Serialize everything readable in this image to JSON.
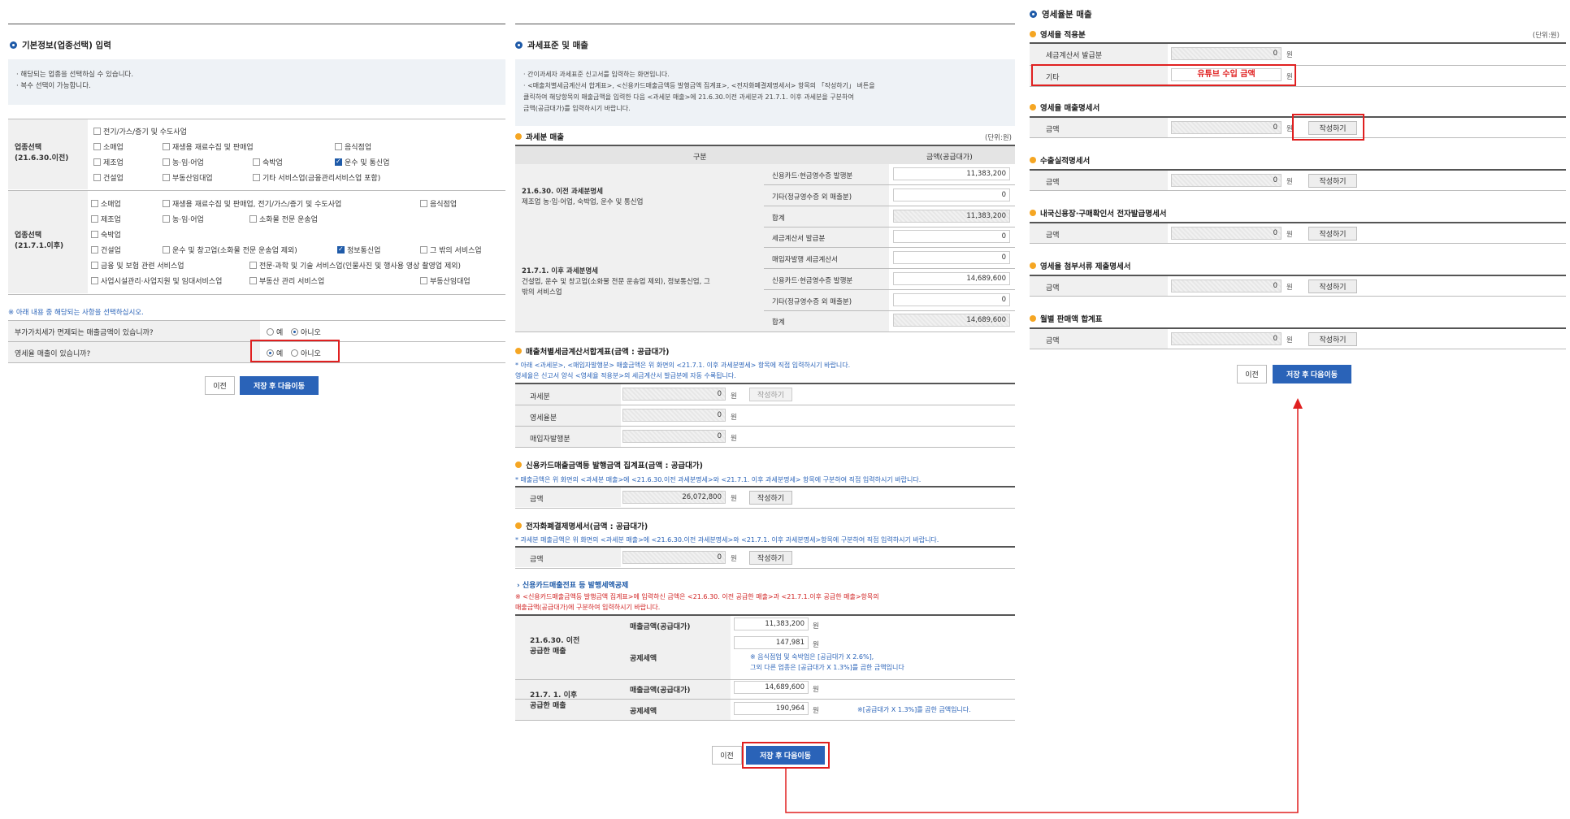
{
  "left": {
    "section_title": "기본정보(업종선택) 입력",
    "info": [
      "· 해당되는 업종을 선택하실 수 있습니다.",
      "· 복수 선택이 가능합니다."
    ],
    "group1_label": [
      "업종선택",
      "(21.6.30.이전)"
    ],
    "group1_options": [
      "전기/가스/증기 및 수도사업",
      "소매업",
      "재생용 재료수집 및 판매업",
      "음식점업",
      "제조업",
      "농·임·어업",
      "숙박업",
      "운수 및 통신업",
      "건설업",
      "부동산임대업",
      "기타 서비스업(금융관리서비스업 포함)"
    ],
    "group2_label": [
      "업종선택",
      "(21.7.1.이후)"
    ],
    "group2_options": [
      "소매업",
      "재생용 재료수집 및 판매업, 전기/가스/증기 및 수도사업",
      "음식점업",
      "제조업",
      "농·임·어업",
      "소화물 전문 운송업",
      "숙박업",
      "건설업",
      "운수 및 창고업(소화물 전문 운송업 제외)",
      "정보통신업",
      "그 밖의 서비스업",
      "금융 및 보험 관련 서비스업",
      "전문·과학 및 기술 서비스업(인물사진 및 행사용 영상 촬영업 제외)",
      "사업시설관리·사업지원 및 임대서비스업",
      "부동산 관리 서비스업",
      "부동산임대업"
    ],
    "notice": "※ 아래 내용 중 해당되는 사항을 선택하십시오.",
    "q1": "부가가치세가 면제되는 매출금액이 있습니까?",
    "q2": "영세율 매출이 있습니까?",
    "yes": "예",
    "no": "아니오",
    "btn_prev": "이전",
    "btn_save": "저장 후 다음이동"
  },
  "mid": {
    "section_title": "과세표준 및 매출",
    "info": [
      "· 간이과세자 과세표준 신고서를 입력하는 화면입니다.",
      "· <매출처별세금계산서 합계표>, <신용카드매출금액등 발행금액 집계표>, <전자화폐결제명세서> 항목의 「작성하기」 버튼을",
      "  클릭하여 해당항목의 매출금액을 입력한 다음 <과세분 매출>에 21.6.30.이전 과세분과 21.7.1. 이후 과세분을 구분하여",
      "  금액(공급대가)를 입력하시기 바랍니다."
    ],
    "taxable_title": "과세분 매출",
    "unit": "(단위:원)",
    "col_div": "구분",
    "col_amount": "금액(공급대가)",
    "group_before": [
      "21.6.30. 이전 과세분명세",
      "제조업 농·임·어업, 숙박업, 운수 및 통신업"
    ],
    "group_after": [
      "21.7.1. 이후 과세분명세",
      "건설업, 운수 및 창고업(소화물 전문 운송업 제외), 정보통신업, 그",
      "밖의 서비스업"
    ],
    "rows": [
      {
        "label": "신용카드·현금영수증 발행분",
        "value": "11,383,200"
      },
      {
        "label": "기타(정규영수증 외 매출분)",
        "value": "0"
      },
      {
        "label": "합계",
        "value": "11,383,200"
      },
      {
        "label": "세금계산서 발급분",
        "value": "0"
      },
      {
        "label": "매입자발행 세금계산서",
        "value": "0"
      },
      {
        "label": "신용카드·현금영수증 발행분",
        "value": "14,689,600"
      },
      {
        "label": "기타(정규영수증 외 매출분)",
        "value": "0"
      },
      {
        "label": "합계",
        "value": "14,689,600"
      }
    ],
    "sales_invoice_title": "매출처별세금계산서합계표(금액 : 공급대가)",
    "sales_invoice_note": [
      "* 아래 <과세분>, <매입자발행분> 매출금액은 위 화면의 <21.7.1. 이후 과세분명세> 항목에 직접 입력하시기 바랍니다.",
      "  영세율은 신고서 양식 <영세율 적용분>의 세금계산서 발급분에 자동 수록됩니다."
    ],
    "si_rows": [
      {
        "label": "과세분",
        "value": "0"
      },
      {
        "label": "영세율분",
        "value": "0"
      },
      {
        "label": "매입자발행분",
        "value": "0"
      }
    ],
    "card_title": "신용카드매출금액등 발행금액 집계표(금액 : 공급대가)",
    "card_note": "* 매출금액은 위 화면의 <과세분 매출>에 <21.6.30.이전 과세분명세>와 <21.7.1. 이후 과세분명세> 항목에 구분하여 직접 입력하시기 바랍니다.",
    "card_value": "26,072,800",
    "emoney_title": "전자화폐결제명세서(금액 : 공급대가)",
    "emoney_note": "* 과세분 매출금액은 위 화면의 <과세분 매출>에 <21.6.30.이전 과세분명세>와 <21.7.1. 이후 과세분명세>항목에 구분하여 직접 입력하시기 바랍니다.",
    "emoney_value": "0",
    "amount_label": "금액",
    "won": "원",
    "write_btn": "작성하기",
    "credit_title": "› 신용카드매출전표 등 발행세액공제",
    "credit_note": [
      "※ <신용카드매출금액등 발행금액 집계표>에 입력하신 금액은 <21.6.30. 이전 공급한 매출>과 <21.7.1.이후 공급한 매출>항목의",
      "   매출금액(공급대가)에 구분하여 입력하시기 바랍니다."
    ],
    "cr_before_label": [
      "21.6.30. 이전",
      "공급한 매출"
    ],
    "cr_after_label": [
      "21.7. 1. 이후",
      "공급한 매출"
    ],
    "cr_sales_label": "매출금액(공급대가)",
    "cr_deduct_label": "공제세액",
    "cr_before_sales": "11,383,200",
    "cr_before_deduct": "147,981",
    "cr_before_note": [
      "※ 음식점업 및 숙박업은 [공급대가 X 2.6%],",
      "   그외 다른 업종은 [공급대가 X 1.3%]를 곱한 금액입니다"
    ],
    "cr_after_sales": "14,689,600",
    "cr_after_deduct": "190,964",
    "cr_after_note": "※[공급대가 X 1.3%]를 곱한 금액입니다.",
    "btn_prev": "이전",
    "btn_save": "저장 후 다음이동"
  },
  "right": {
    "section_title": "영세율분 매출",
    "unit": "(단위:원)",
    "applied_title": "영세율 적용분",
    "invoice_label": "세금계산서 발급분",
    "invoice_value": "0",
    "etc_label": "기타",
    "etc_value": "유튜브 수입 금액",
    "groups": [
      {
        "title": "영세율 매출명세서",
        "label": "금액",
        "value": "0"
      },
      {
        "title": "수출실적명세서",
        "label": "금액",
        "value": "0"
      },
      {
        "title": "내국신용장·구매확인서 전자발급명세서",
        "label": "금액",
        "value": "0"
      },
      {
        "title": "영세율 첨부서류 제출명세서",
        "label": "금액",
        "value": "0"
      },
      {
        "title": "월별 판매액 합계표",
        "label": "금액",
        "value": "0"
      }
    ],
    "won": "원",
    "write_btn": "작성하기",
    "btn_prev": "이전",
    "btn_save": "저장 후 다음이동"
  },
  "colors": {
    "accent": "#2a63b8",
    "highlight": "#e02020",
    "orange": "#f5a623"
  }
}
